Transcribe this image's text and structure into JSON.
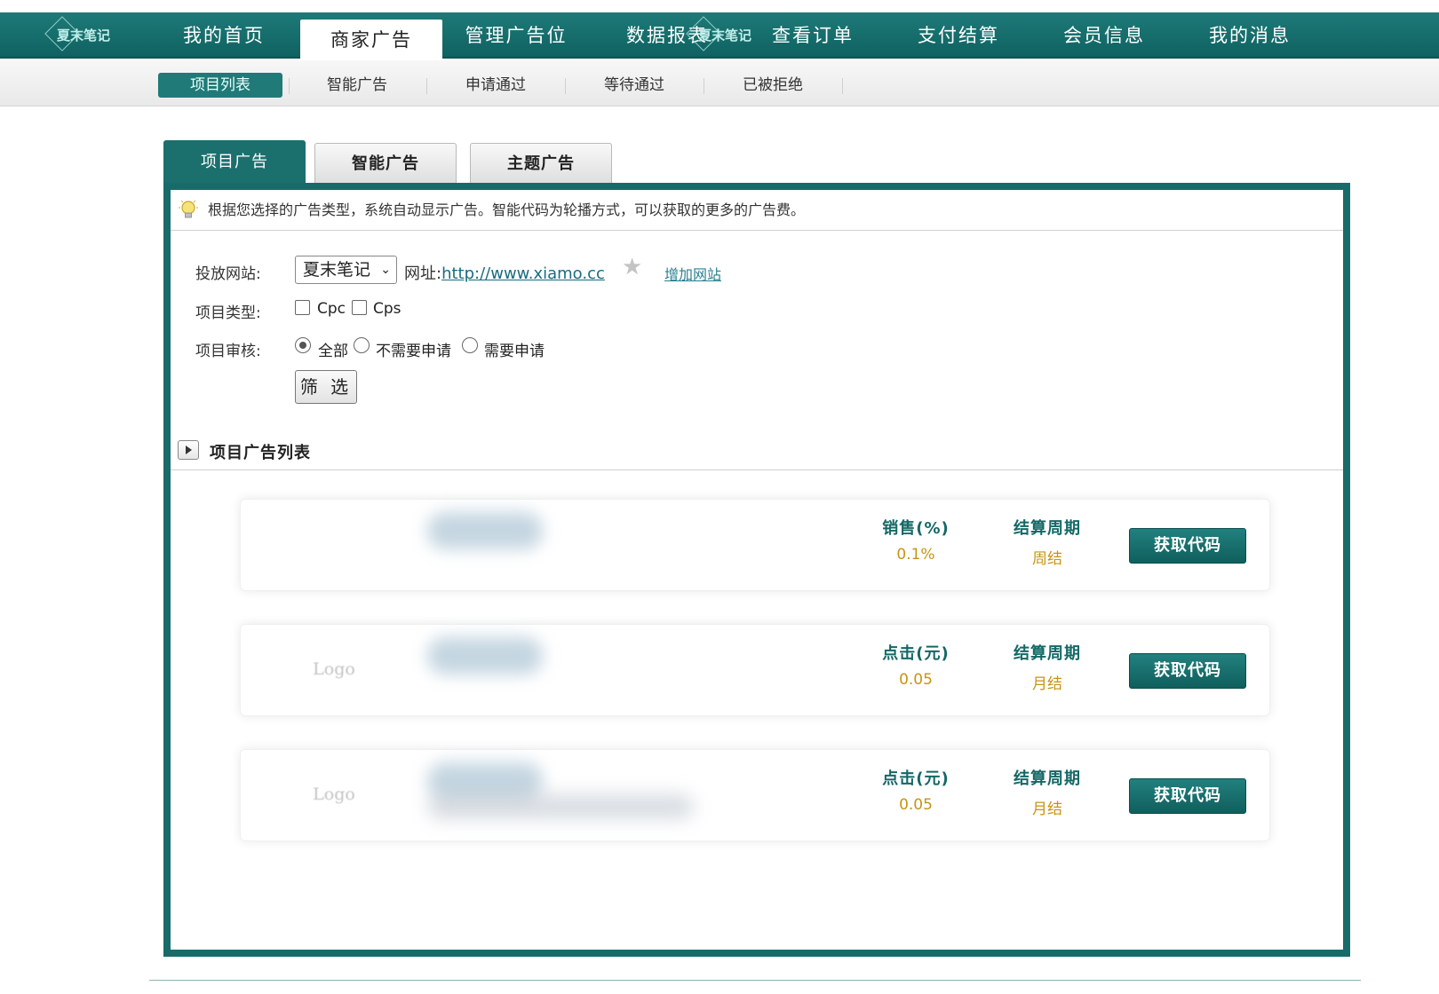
{
  "topnav": {
    "logo_text": "夏末笔记",
    "items": [
      {
        "label": "我的首页"
      },
      {
        "label": "商家广告"
      },
      {
        "label": "管理广告位"
      },
      {
        "label": "数据报表"
      },
      {
        "label": "查看订单"
      },
      {
        "label": "支付结算"
      },
      {
        "label": "会员信息"
      },
      {
        "label": "我的消息"
      }
    ],
    "active_index": 1
  },
  "subnav": {
    "items": [
      {
        "label": "项目列表"
      },
      {
        "label": "智能广告"
      },
      {
        "label": "申请通过"
      },
      {
        "label": "等待通过"
      },
      {
        "label": "已被拒绝"
      }
    ],
    "active_index": 0
  },
  "panel_tabs": [
    {
      "label": "项目广告"
    },
    {
      "label": "智能广告"
    },
    {
      "label": "主题广告"
    }
  ],
  "tip": "根据您选择的广告类型，系统自动显示广告。智能代码为轮播方式，可以获取的更多的广告费。",
  "filters": {
    "site_label": "投放网站:",
    "site_value": "夏末笔记",
    "url_label": "网址:",
    "url_value": "http://www.xiamo.cc",
    "add_site": "增加网站",
    "type_label": "项目类型:",
    "type_options": [
      {
        "label": "Cpc",
        "checked": false
      },
      {
        "label": "Cps",
        "checked": false
      }
    ],
    "review_label": "项目审核:",
    "review_options": [
      {
        "label": "全部",
        "checked": true
      },
      {
        "label": "不需要申请",
        "checked": false
      },
      {
        "label": "需要申请",
        "checked": false
      }
    ],
    "filter_button": "筛 选"
  },
  "list": {
    "title": "项目广告列表",
    "cards": [
      {
        "logo": "",
        "metric_label": "销售(%)",
        "metric_value": "0.1%",
        "cycle_label": "结算周期",
        "cycle_value": "周结",
        "button": "获取代码"
      },
      {
        "logo": "Logo",
        "metric_label": "点击(元)",
        "metric_value": "0.05",
        "cycle_label": "结算周期",
        "cycle_value": "月结",
        "button": "获取代码"
      },
      {
        "logo": "Logo",
        "metric_label": "点击(元)",
        "metric_value": "0.05",
        "cycle_label": "结算周期",
        "cycle_value": "月结",
        "button": "获取代码"
      }
    ]
  },
  "colors": {
    "brand_teal": "#176c6a",
    "value_gold": "#c79414",
    "link": "#1a6b80"
  }
}
